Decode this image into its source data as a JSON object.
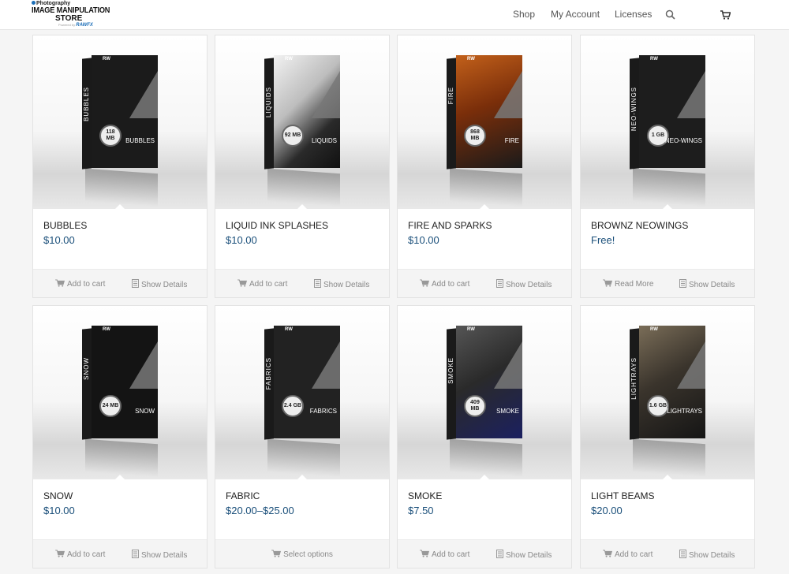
{
  "header": {
    "logo": {
      "line1": "Photography",
      "line2": "IMAGE MANIPULATION",
      "line3": "STORE",
      "powered": "Powered by",
      "powered_brand": "RAWFX"
    },
    "nav": [
      {
        "label": "Shop"
      },
      {
        "label": "My Account"
      },
      {
        "label": "Licenses"
      }
    ],
    "icons": [
      "search-icon",
      "cart-icon"
    ]
  },
  "colors": {
    "price": "#1a4f7a",
    "action_text": "#888888",
    "card_border": "#e3e3e3"
  },
  "products": [
    {
      "title": "BUBBLES",
      "price": "$10.00",
      "box_name": "BUBBLES",
      "spine": "BUBBLES",
      "size": "118 MB",
      "color": "#1b1b1b",
      "actions": [
        "Add to cart",
        "Show Details"
      ]
    },
    {
      "title": "LIQUID INK SPLASHES",
      "price": "$10.00",
      "box_name": "LIQUIDS",
      "spine": "LIQUIDS",
      "size": "92 MB",
      "color": "#d8d8d8",
      "actions": [
        "Add to cart",
        "Show Details"
      ]
    },
    {
      "title": "FIRE AND SPARKS",
      "price": "$10.00",
      "box_name": "FIRE",
      "spine": "FIRE",
      "size": "868 MB",
      "color": "#8a3b10",
      "actions": [
        "Add to cart",
        "Show Details"
      ]
    },
    {
      "title": "BROWNZ NEOWINGS",
      "price": "Free!",
      "box_name": "NEO-WINGS",
      "spine": "NEO-WINGS",
      "size": "1 GB",
      "color": "#1d1d1d",
      "actions": [
        "Read More",
        "Show Details"
      ]
    },
    {
      "title": "SNOW",
      "price": "$10.00",
      "box_name": "SNOW",
      "spine": "SNOW",
      "size": "24 MB",
      "color": "#141414",
      "actions": [
        "Add to cart",
        "Show Details"
      ]
    },
    {
      "title": "FABRIC",
      "price": "$20.00–$25.00",
      "box_name": "FABRICS",
      "spine": "FABRICS",
      "size": "2.4 GB",
      "color": "#222222",
      "actions": [
        "Select options"
      ]
    },
    {
      "title": "SMOKE",
      "price": "$7.50",
      "box_name": "SMOKE",
      "spine": "SMOKE",
      "size": "409 MB",
      "color": "#2a2a2a",
      "actions": [
        "Add to cart",
        "Show Details"
      ]
    },
    {
      "title": "LIGHT BEAMS",
      "price": "$20.00",
      "box_name": "LIGHTRAYS",
      "spine": "LIGHTRAYS",
      "size": "1.6 GB",
      "color": "#3a342c",
      "actions": [
        "Add to cart",
        "Show Details"
      ]
    }
  ]
}
